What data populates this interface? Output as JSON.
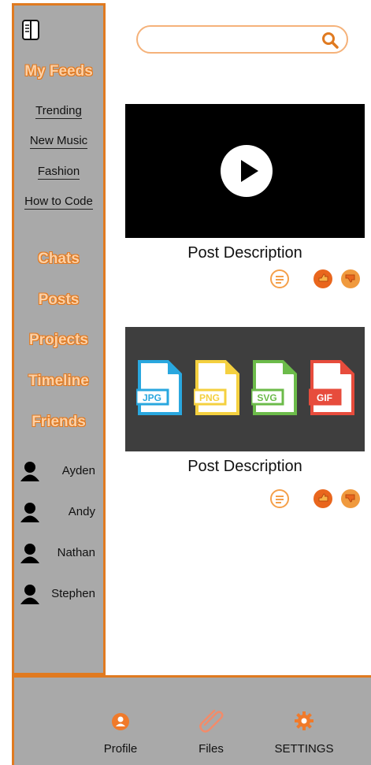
{
  "sidebar": {
    "my_feeds": "My Feeds",
    "feeds": [
      "Trending",
      "New Music",
      "Fashion",
      "How to Code"
    ],
    "sections": [
      "Chats",
      "Posts",
      "Projects",
      "Timeline",
      "Friends"
    ],
    "friends": [
      "Ayden",
      "Andy",
      "Nathan",
      "Stephen"
    ]
  },
  "search": {
    "placeholder": ""
  },
  "posts": [
    {
      "description": "Post Description"
    },
    {
      "description": "Post Description",
      "file_types": [
        "JPG",
        "PNG",
        "SVG",
        "GIF"
      ]
    }
  ],
  "bottom_nav": {
    "profile": "Profile",
    "files": "Files",
    "settings": "SETTINGS"
  },
  "colors": {
    "accent": "#e07a20",
    "panel": "#a9a9a9"
  }
}
